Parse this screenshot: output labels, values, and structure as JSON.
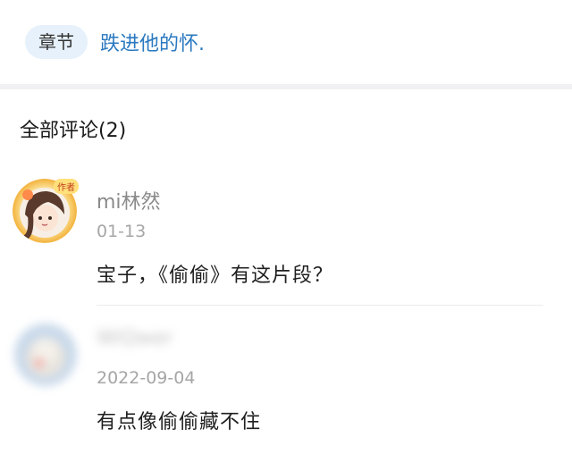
{
  "chapter": {
    "tag": "章节",
    "title": "跌进他的怀."
  },
  "comments_header": "全部评论(2)",
  "comments": [
    {
      "username": "mi林然",
      "date": "01-13",
      "text": "宝子，《偷偷》有这片段？",
      "badge": "作者"
    },
    {
      "username": "WiQwer",
      "date": "2022-09-04",
      "text": "有点像偷偷藏不住"
    }
  ],
  "colors": {
    "accent": "#2a79c0",
    "pill_bg": "#e6f1fb",
    "muted": "#8a8a8a"
  }
}
